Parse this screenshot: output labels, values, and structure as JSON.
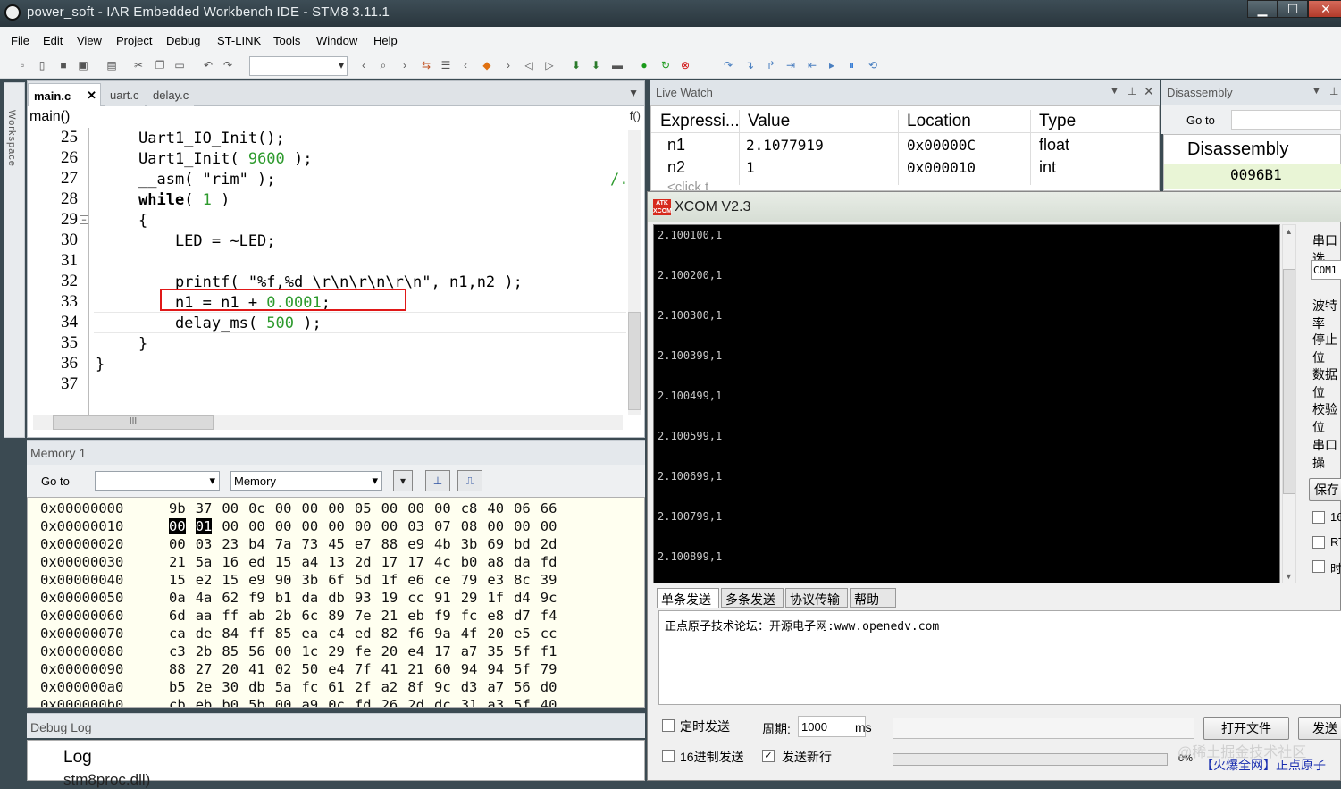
{
  "window": {
    "title": "power_soft - IAR Embedded Workbench IDE - STM8 3.11.1",
    "min": "▁",
    "max": "☐",
    "close": "✕"
  },
  "menu": [
    "File",
    "Edit",
    "View",
    "Project",
    "Debug",
    "ST-LINK",
    "Tools",
    "Window",
    "Help"
  ],
  "editor": {
    "tabs": [
      {
        "label": "main.c",
        "active": true,
        "close": "✕"
      },
      {
        "label": "uart.c"
      },
      {
        "label": "delay.c"
      }
    ],
    "function": "main()",
    "fx": "f()",
    "workspace_label": "Workspace",
    "lines": [
      {
        "n": "25",
        "code": "Uart1_IO_Init();"
      },
      {
        "n": "26",
        "pre": "Uart1_Init( ",
        "num": "9600",
        "post": " );"
      },
      {
        "n": "27",
        "code": "__asm( \"rim\" );",
        "trail": "/."
      },
      {
        "n": "28",
        "kw": "while",
        "pre": "( ",
        "num": "1",
        "post": " )"
      },
      {
        "n": "29",
        "code": "{"
      },
      {
        "n": "30",
        "code": "    LED = ~LED;"
      },
      {
        "n": "31",
        "code": ""
      },
      {
        "n": "32",
        "code": "    printf( \"%f,%d \\r\\n\\r\\n\\r\\n\", n1,n2 );"
      },
      {
        "n": "33",
        "pre": "    n1 = n1 + ",
        "num": "0.0001",
        "post": ";"
      },
      {
        "n": "34",
        "pre": "    delay_ms( ",
        "num": "500",
        "post": " );"
      },
      {
        "n": "35",
        "code": "}"
      },
      {
        "n": "36",
        "code": "}"
      },
      {
        "n": "37",
        "code": ""
      }
    ],
    "hscroll_label": "III"
  },
  "memory": {
    "title": "Memory 1",
    "goto_label": "Go to",
    "goto_value": "",
    "zone": "Memory",
    "rows": [
      {
        "addr": "0x00000000",
        "bytes": [
          "9b",
          "37",
          "00",
          "0c",
          "00",
          "00",
          "00",
          "05",
          "00",
          "00",
          "00",
          "c8",
          "40",
          "06",
          "66"
        ]
      },
      {
        "addr": "0x00000010",
        "bytes": [
          "00",
          "01",
          "00",
          "00",
          "00",
          "00",
          "00",
          "00",
          "00",
          "03",
          "07",
          "08",
          "00",
          "00",
          "00"
        ]
      },
      {
        "addr": "0x00000020",
        "bytes": [
          "00",
          "03",
          "23",
          "b4",
          "7a",
          "73",
          "45",
          "e7",
          "88",
          "e9",
          "4b",
          "3b",
          "69",
          "bd",
          "2d"
        ]
      },
      {
        "addr": "0x00000030",
        "bytes": [
          "21",
          "5a",
          "16",
          "ed",
          "15",
          "a4",
          "13",
          "2d",
          "17",
          "17",
          "4c",
          "b0",
          "a8",
          "da",
          "fd"
        ]
      },
      {
        "addr": "0x00000040",
        "bytes": [
          "15",
          "e2",
          "15",
          "e9",
          "90",
          "3b",
          "6f",
          "5d",
          "1f",
          "e6",
          "ce",
          "79",
          "e3",
          "8c",
          "39"
        ]
      },
      {
        "addr": "0x00000050",
        "bytes": [
          "0a",
          "4a",
          "62",
          "f9",
          "b1",
          "da",
          "db",
          "93",
          "19",
          "cc",
          "91",
          "29",
          "1f",
          "d4",
          "9c"
        ]
      },
      {
        "addr": "0x00000060",
        "bytes": [
          "6d",
          "aa",
          "ff",
          "ab",
          "2b",
          "6c",
          "89",
          "7e",
          "21",
          "eb",
          "f9",
          "fc",
          "e8",
          "d7",
          "f4"
        ]
      },
      {
        "addr": "0x00000070",
        "bytes": [
          "ca",
          "de",
          "84",
          "ff",
          "85",
          "ea",
          "c4",
          "ed",
          "82",
          "f6",
          "9a",
          "4f",
          "20",
          "e5",
          "cc"
        ]
      },
      {
        "addr": "0x00000080",
        "bytes": [
          "c3",
          "2b",
          "85",
          "56",
          "00",
          "1c",
          "29",
          "fe",
          "20",
          "e4",
          "17",
          "a7",
          "35",
          "5f",
          "f1"
        ]
      },
      {
        "addr": "0x00000090",
        "bytes": [
          "88",
          "27",
          "20",
          "41",
          "02",
          "50",
          "e4",
          "7f",
          "41",
          "21",
          "60",
          "94",
          "94",
          "5f",
          "79"
        ]
      },
      {
        "addr": "0x000000a0",
        "bytes": [
          "b5",
          "2e",
          "30",
          "db",
          "5a",
          "fc",
          "61",
          "2f",
          "a2",
          "8f",
          "9c",
          "d3",
          "a7",
          "56",
          "d0"
        ]
      },
      {
        "addr": "0x000000b0",
        "bytes": [
          "cb",
          "eb",
          "b0",
          "5b",
          "00",
          "a9",
          "0c",
          "fd",
          "26",
          "2d",
          "dc",
          "31",
          "a3",
          "5f",
          "40"
        ]
      }
    ]
  },
  "debug_log": {
    "title": "Debug Log",
    "header": "Log",
    "line": "stm8proc.dll)"
  },
  "live_watch": {
    "title": "Live Watch",
    "columns": [
      "Expressi...",
      "Value",
      "Location",
      "Type"
    ],
    "rows": [
      {
        "expr": "n1",
        "value": "2.1077919",
        "location": "0x00000C",
        "type": "float"
      },
      {
        "expr": "n2",
        "value": "1",
        "location": "0x000010",
        "type": "int"
      }
    ],
    "placeholder": "<click t"
  },
  "disassembly": {
    "title": "Disassembly",
    "goto": "Go to",
    "header": "Disassembly",
    "row": "0096B1"
  },
  "xcom": {
    "title": "XCOM V2.3",
    "icon_text": "ATK XCOM",
    "terminal_lines": [
      "2.100100,1",
      "2.100200,1",
      "2.100300,1",
      "2.100399,1",
      "2.100499,1",
      "2.100599,1",
      "2.100699,1",
      "2.100799,1",
      "2.100899,1"
    ],
    "side_labels": [
      "串口选",
      "波特率",
      "停止位",
      "数据位",
      "校验位",
      "串口操"
    ],
    "port_value": "COM1",
    "save_btn": "保存",
    "side_checks": [
      "16",
      "RT",
      "时"
    ],
    "send_tabs": [
      "单条发送",
      "多条发送",
      "协议传输",
      "帮助"
    ],
    "send_text": "正点原子技术论坛：开源电子网:www.openedv.com",
    "timed_send": "定时发送",
    "period_label": "周期:",
    "period_value": "1000",
    "period_unit": "ms",
    "open_file": "打开文件",
    "send": "发送",
    "hex_send": "16进制发送",
    "newline_send": "发送新行",
    "progress": "0%",
    "watermark": "@稀土掘金技术社区",
    "footer_link": "【火爆全网】正点原子"
  }
}
